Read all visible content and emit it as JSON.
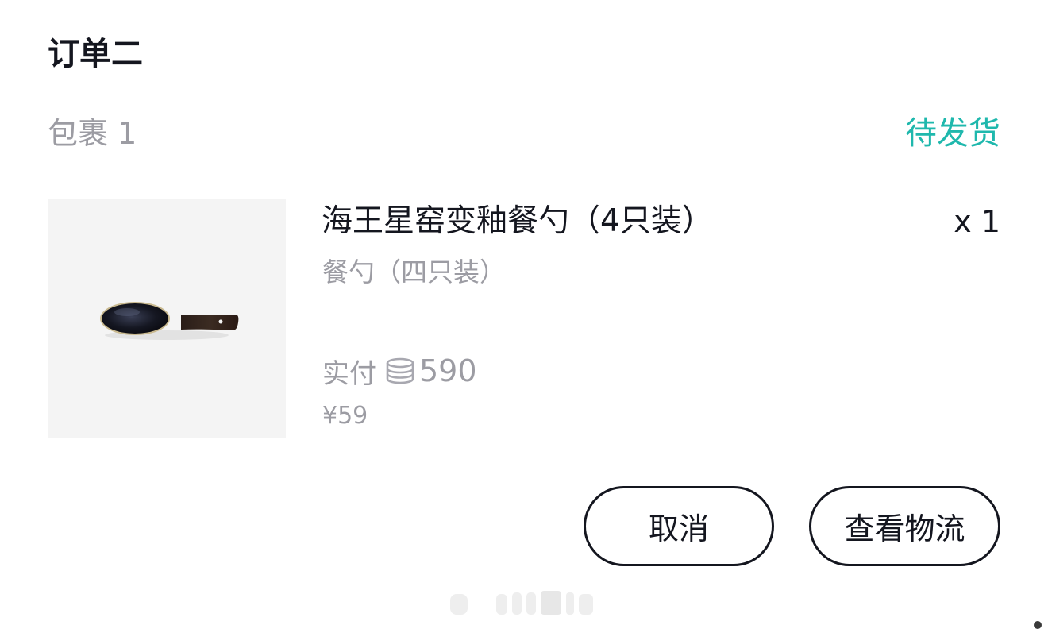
{
  "order": {
    "title": "订单二"
  },
  "package": {
    "label": "包裹 1",
    "status": "待发货",
    "status_color": "#1fb8ad"
  },
  "product": {
    "image_icon": "spoon-icon",
    "name": "海王星窑变釉餐勺（4只装）",
    "quantity": "x 1",
    "variant": "餐勺（四只装）",
    "paid_label": "实付",
    "paid_icon": "coin-stack-icon",
    "paid_value": "590",
    "price": "¥59"
  },
  "actions": {
    "cancel_label": "取消",
    "logistics_label": "查看物流"
  }
}
